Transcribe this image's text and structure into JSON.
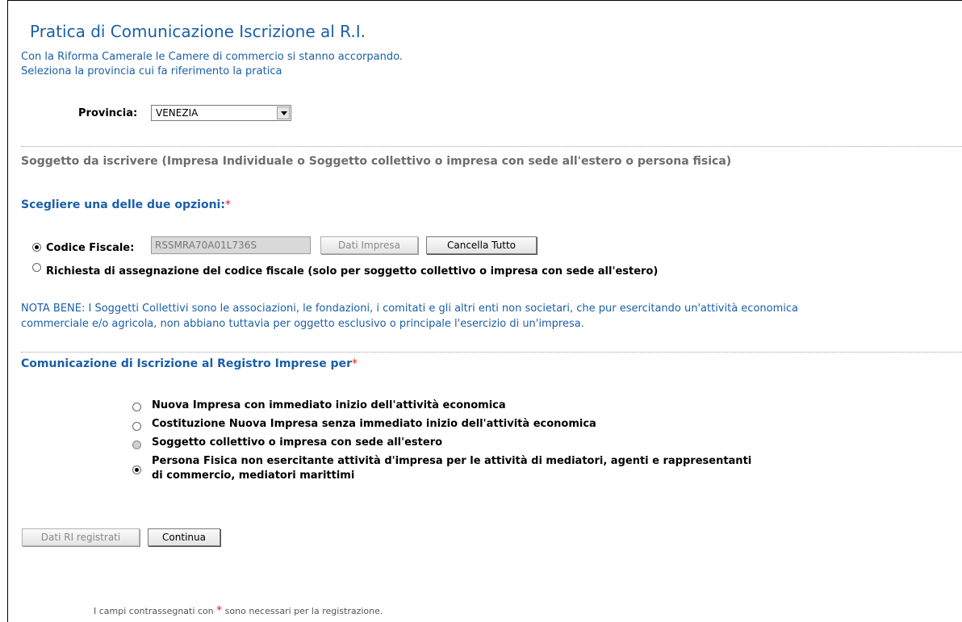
{
  "page": {
    "title": "Pratica di Comunicazione Iscrizione al R.I.",
    "intro_line1": "Con la Riforma Camerale le Camere di commercio si stanno accorpando.",
    "intro_line2": "Seleziona la provincia cui fa riferimento la pratica"
  },
  "provincia": {
    "label": "Provincia:",
    "selected": "VENEZIA"
  },
  "soggetto": {
    "heading": "Soggetto da iscrivere (Impresa Individuale o Soggetto collettivo o impresa con sede all'estero o persona fisica)",
    "choose_label": "Scegliere una delle due opzioni:",
    "required_mark": "*",
    "codice_fiscale_label": "Codice Fiscale:",
    "codice_fiscale_value": "RSSMRA70A01L736S",
    "dati_impresa_button": "Dati Impresa",
    "cancella_button": "Cancella Tutto",
    "richiesta_option": "Richiesta di assegnazione del codice fiscale (solo per soggetto collettivo o impresa con sede all'estero)"
  },
  "nota": {
    "line1": "NOTA BENE: I Soggetti Collettivi sono le associazioni, le fondazioni, i comitati e gli altri enti non societari, che pur esercitando un'attività economica",
    "line2": "commerciale e/o agricola, non abbiano tuttavia per oggetto esclusivo o principale l'esercizio di un'impresa."
  },
  "comunicazione": {
    "heading": "Comunicazione di Iscrizione al Registro Imprese per",
    "required_mark": "*",
    "options": [
      {
        "label": "Nuova Impresa con immediato inizio dell'attività economica"
      },
      {
        "label": "Costituzione Nuova Impresa senza immediato inizio dell'attività economica"
      },
      {
        "label": "Soggetto collettivo o impresa con sede all'estero"
      },
      {
        "label_line1": "Persona Fisica non esercitante attività d'impresa per le attività di mediatori, agenti e rappresentanti",
        "label_line2": "di commercio, mediatori marittimi"
      }
    ]
  },
  "actions": {
    "dati_ri_button": "Dati RI registrati",
    "continua_button": "Continua"
  },
  "footer": {
    "before": "I campi contrassegnati con",
    "mark": "*",
    "after": "sono necessari per la registrazione."
  },
  "colors": {
    "title_blue": "#1b5fa7",
    "required_red": "#e02020",
    "grey_heading": "#6d6d6d"
  }
}
